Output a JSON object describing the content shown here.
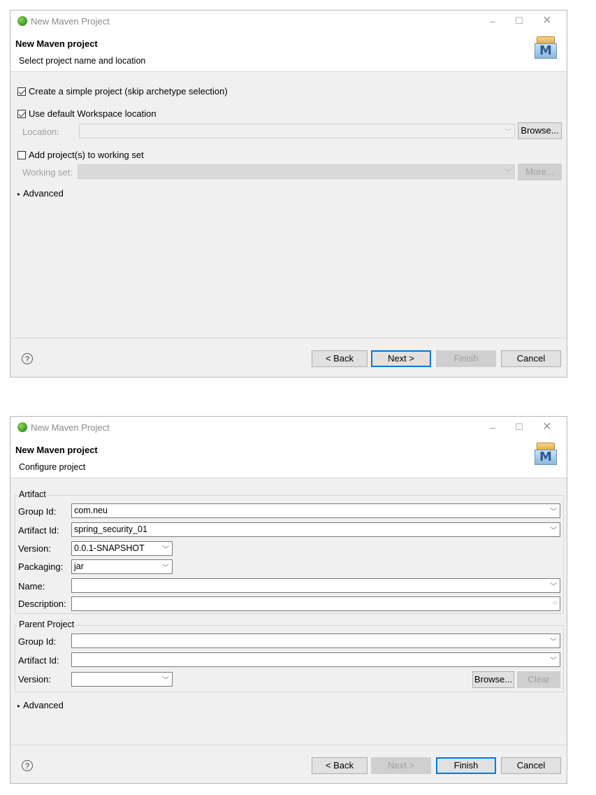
{
  "dialog1": {
    "window_title": "New Maven Project",
    "header_title": "New Maven project",
    "header_subtitle": "Select project name and location",
    "simple_project": {
      "label": "Create a simple project (skip archetype selection)",
      "checked": true
    },
    "default_workspace": {
      "label": "Use default Workspace location",
      "checked": true
    },
    "location_label": "Location:",
    "location_value": "",
    "browse_label": "Browse...",
    "working_set_checkbox": {
      "label": "Add project(s) to working set",
      "checked": false
    },
    "working_set_label": "Working set:",
    "working_set_value": "",
    "more_label": "More...",
    "advanced_label": "Advanced",
    "buttons": {
      "back": "< Back",
      "next": "Next >",
      "finish": "Finish",
      "cancel": "Cancel"
    },
    "help_icon": "?"
  },
  "dialog2": {
    "window_title": "New Maven Project",
    "header_title": "New Maven project",
    "header_subtitle": "Configure project",
    "artifact_group": "Artifact",
    "group_id_label": "Group Id:",
    "group_id_value": "com.neu",
    "artifact_id_label": "Artifact Id:",
    "artifact_id_value": "spring_security_01",
    "version_label": "Version:",
    "version_value": "0.0.1-SNAPSHOT",
    "packaging_label": "Packaging:",
    "packaging_value": "jar",
    "name_label": "Name:",
    "name_value": "",
    "description_label": "Description:",
    "description_value": "",
    "parent_group": "Parent Project",
    "parent_group_id_label": "Group Id:",
    "parent_group_id_value": "",
    "parent_artifact_id_label": "Artifact Id:",
    "parent_artifact_id_value": "",
    "parent_version_label": "Version:",
    "parent_version_value": "",
    "browse_label": "Browse...",
    "clear_label": "Clear",
    "advanced_label": "Advanced",
    "buttons": {
      "back": "< Back",
      "next": "Next >",
      "finish": "Finish",
      "cancel": "Cancel"
    },
    "help_icon": "?"
  },
  "icons": {
    "app": "eclipse-spring-icon",
    "maven": "maven-m-icon",
    "minimize": "–",
    "maximize": "☐",
    "close": "✕",
    "chevron": "﹀",
    "tri": "▸"
  }
}
